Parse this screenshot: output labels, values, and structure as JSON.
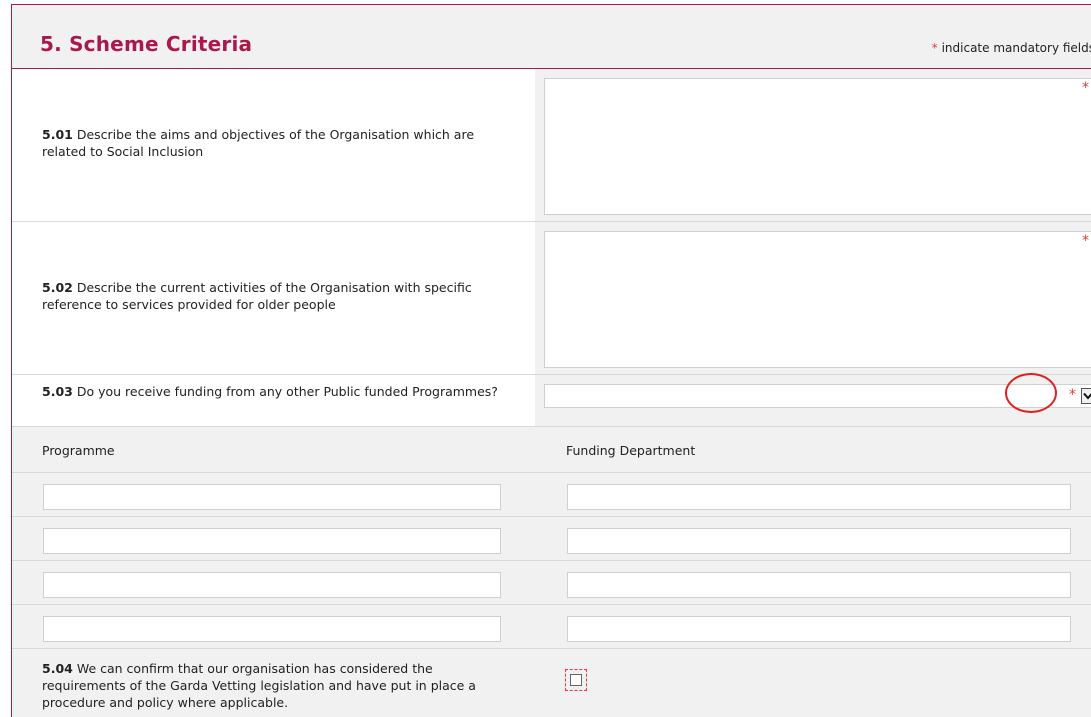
{
  "section": {
    "title": "5. Scheme Criteria",
    "mandatory_star": "*",
    "mandatory_note": "indicate mandatory fields"
  },
  "questions": {
    "q501": {
      "number": "5.01",
      "text": "Describe the aims and objectives of the Organisation which are related to Social Inclusion",
      "value": "",
      "required": "*"
    },
    "q502": {
      "number": "5.02",
      "text": "Describe the current activities of the Organisation with specific reference to services provided for older people",
      "value": "",
      "required": "*"
    },
    "q503": {
      "number": "5.03",
      "text": "Do you receive funding from any other Public funded Programmes?",
      "selected": "",
      "required": "*",
      "dropdown_icon": "chevron-down-icon"
    },
    "q504": {
      "number": "5.04",
      "text": "We can confirm that our organisation has considered the requirements of the Garda Vetting legislation and have put in place a procedure and policy where applicable.",
      "checked": false
    }
  },
  "funding_table": {
    "headers": [
      "Programme",
      "Funding Department"
    ],
    "rows": [
      {
        "programme": "",
        "department": ""
      },
      {
        "programme": "",
        "department": ""
      },
      {
        "programme": "",
        "department": ""
      },
      {
        "programme": "",
        "department": ""
      }
    ]
  },
  "colors": {
    "brand": "#a8194e",
    "required": "#e53935",
    "panel": "#f1f1f1"
  }
}
